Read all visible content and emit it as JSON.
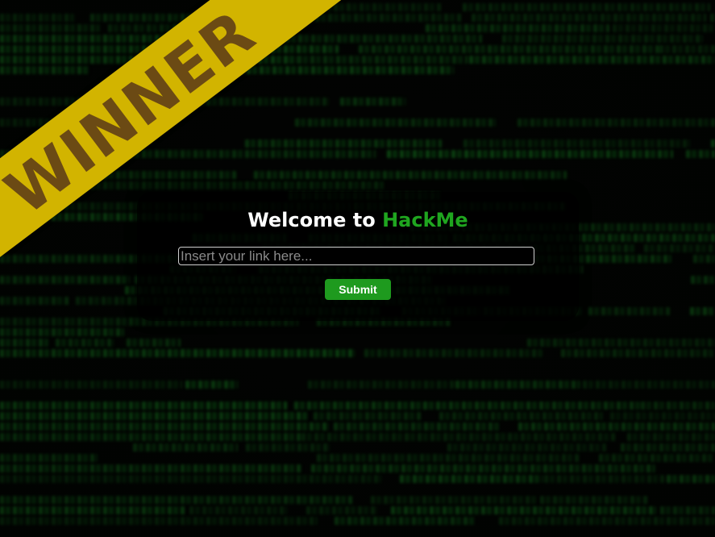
{
  "ribbon": {
    "text": "WINNER",
    "color": "#d2b400",
    "text_color": "#6b4a14"
  },
  "card": {
    "title_prefix": "Welcome to ",
    "title_brand": "HackMe",
    "brand_color": "#1fa51f"
  },
  "form": {
    "link_input": {
      "value": "",
      "placeholder": "Insert your link here..."
    },
    "submit_label": "Submit",
    "button_color": "#1e9a1e"
  },
  "background": {
    "theme": "green-code-matrix",
    "accent": "#148a1e"
  }
}
